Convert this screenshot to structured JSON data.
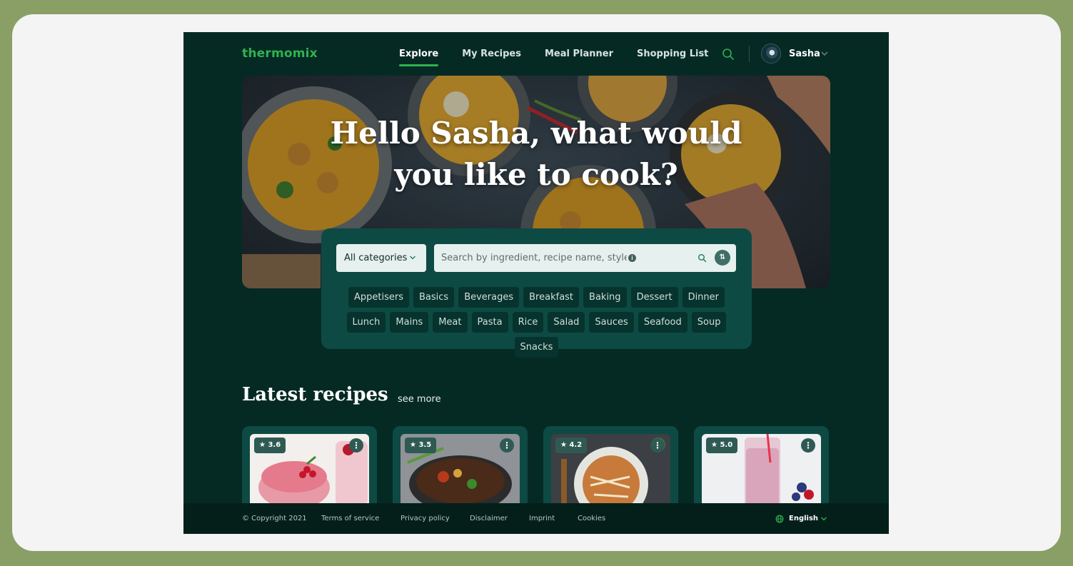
{
  "colors": {
    "frame_bg": "#8a9f66",
    "card_bg": "#f4f4f4",
    "app_bg": "#052a24",
    "panel_bg": "#0d4a43",
    "accent": "#2fb34f"
  },
  "header": {
    "logo": "thermomix",
    "nav": [
      {
        "label": "Explore",
        "active": true
      },
      {
        "label": "My Recipes",
        "active": false
      },
      {
        "label": "Meal Planner",
        "active": false
      },
      {
        "label": "Shopping List",
        "active": false
      }
    ],
    "search_icon": "search-icon",
    "user": {
      "name": "Sasha",
      "avatar_icon": "avatar-icon",
      "menu_icon": "chevron-down-icon"
    }
  },
  "hero": {
    "title": "Hello Sasha, what would you like to cook?"
  },
  "search": {
    "category_select": "All categories",
    "placeholder": "Search by ingredient, recipe name, style...",
    "info_icon": "info-icon",
    "search_icon": "search-icon",
    "filter_icon": "filter-icon",
    "categories": [
      "Appetisers",
      "Basics",
      "Beverages",
      "Breakfast",
      "Baking",
      "Dessert",
      "Dinner",
      "Lunch",
      "Mains",
      "Meat",
      "Pasta",
      "Rice",
      "Salad",
      "Sauces",
      "Seafood",
      "Soup",
      "Snacks"
    ]
  },
  "latest": {
    "title": "Latest recipes",
    "see_more": "see more",
    "cards": [
      {
        "rating": "3.6"
      },
      {
        "rating": "3.5"
      },
      {
        "rating": "4.2"
      },
      {
        "rating": "5.0"
      }
    ]
  },
  "footer": {
    "copyright": "© Copyright 2021",
    "links": [
      "Terms of service",
      "Privacy policy",
      "Disclaimer",
      "Imprint",
      "Cookies"
    ],
    "language": "English"
  }
}
